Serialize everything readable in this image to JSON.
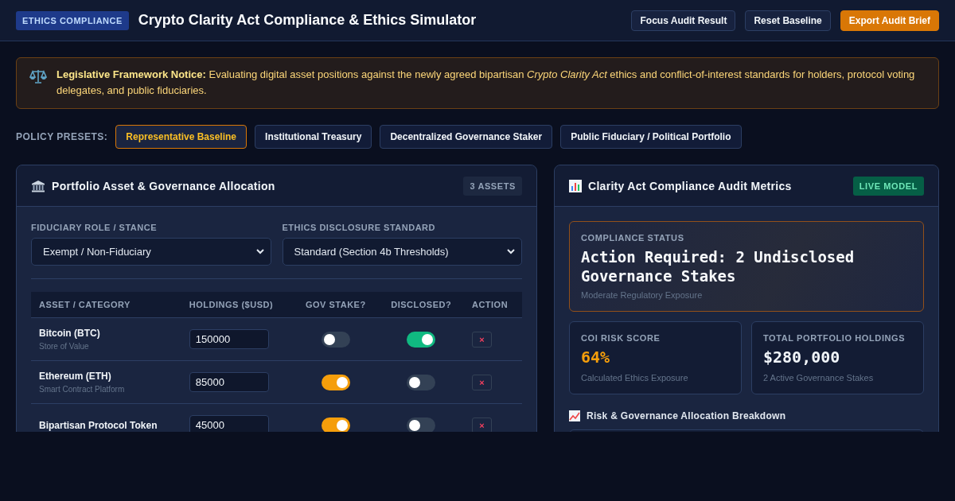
{
  "header": {
    "badge": "ETHICS COMPLIANCE",
    "title": "Crypto Clarity Act Compliance & Ethics Simulator",
    "buttons": [
      {
        "label": "Focus Audit Result",
        "kind": "secondary"
      },
      {
        "label": "Reset Baseline",
        "kind": "secondary"
      },
      {
        "label": "Export Audit Brief",
        "kind": "primary"
      }
    ]
  },
  "notice": {
    "text": "**Legislative Framework Notice:** Evaluating digital asset positions against the newly agreed bipartisan *Crypto Clarity Act* ethics and conflict-of-interest standards for holders, protocol voting delegates, and public fiduciaries."
  },
  "presets": {
    "label": "POLICY PRESETS:",
    "items": [
      {
        "label": "Representative Baseline",
        "selected": true
      },
      {
        "label": "Institutional Treasury",
        "selected": false
      },
      {
        "label": "Decentralized Governance Staker",
        "selected": false
      },
      {
        "label": "Public Fiduciary / Political Portfolio",
        "selected": false
      }
    ]
  },
  "portfolio": {
    "title": "Portfolio Asset & Governance Allocation",
    "badge": "3 ASSETS",
    "fields": [
      {
        "label": "FIDUCIARY ROLE / STANCE",
        "value": "Exempt / Non-Fiduciary"
      },
      {
        "label": "ETHICS DISCLOSURE STANDARD",
        "value": "Standard (Section 4b Thresholds)"
      }
    ],
    "columns": [
      "ASSET / CATEGORY",
      "HOLDINGS ($USD)",
      "GOV STAKE?",
      "DISCLOSED?",
      "ACTION"
    ],
    "rows": [
      {
        "name": "Bitcoin (BTC)",
        "category": "Store of Value",
        "holdings": "150000",
        "gov_stake": false,
        "disclosed": true,
        "action": "×"
      },
      {
        "name": "Ethereum (ETH)",
        "category": "Smart Contract Platform",
        "holdings": "85000",
        "gov_stake": true,
        "disclosed": false,
        "action": "×"
      },
      {
        "name": "Bipartisan Protocol Token",
        "holdings": "45000",
        "gov_stake": true,
        "disclosed": false,
        "action": "×"
      }
    ]
  },
  "audit": {
    "title": "Clarity Act Compliance Audit Metrics",
    "badge": "LIVE MODEL",
    "status": {
      "label": "COMPLIANCE STATUS",
      "headline": "Action Required: 2 Undisclosed Governance Stakes",
      "note": "Moderate Regulatory Exposure"
    },
    "metrics": [
      {
        "label": "COI RISK SCORE",
        "value": "64%",
        "note": "Calculated Ethics Exposure",
        "color": "#f59e0b"
      },
      {
        "label": "TOTAL PORTFOLIO HOLDINGS",
        "value": "$280,000",
        "note": "2 Active Governance Stakes",
        "color": "#f1f5f9"
      }
    ],
    "breakdown_title": "Risk & Governance Allocation Breakdown"
  }
}
